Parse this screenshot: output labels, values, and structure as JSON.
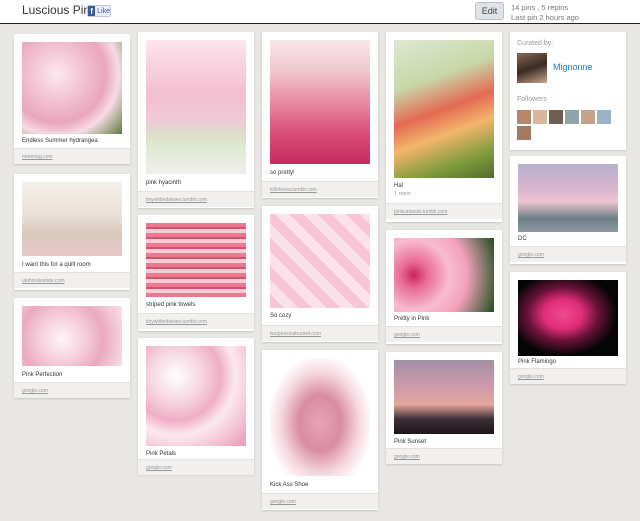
{
  "header": {
    "board_title": "Luscious Pink",
    "fb_like": "Like",
    "edit_label": "Edit",
    "stats_line1": "14 pins , 5 repins",
    "stats_line2": "Last pin 2 hours ago"
  },
  "sidebar": {
    "curated_by_label": "Curated by:",
    "curator_name": "Mignonne",
    "followers_label": "Followers",
    "followers": [
      "follower-1",
      "follower-2",
      "follower-3",
      "follower-4",
      "follower-5",
      "follower-6",
      "follower-7"
    ]
  },
  "pins": [
    {
      "desc": "Endless Summer hydrangea",
      "source": "marenag.com",
      "repins": ""
    },
    {
      "desc": "I want this for a quilt room",
      "source": "utahrealestate.com",
      "repins": ""
    },
    {
      "desc": "Pink Perfection",
      "source": "google.com",
      "repins": ""
    },
    {
      "desc": "pink hyacinth",
      "source": "tinywhitedaisies.tumblr.com",
      "repins": ""
    },
    {
      "desc": "striped pink towels",
      "source": "tinywhitedaisies.tumblr.com",
      "repins": ""
    },
    {
      "desc": "Pink Petals",
      "source": "google.com",
      "repins": ""
    },
    {
      "desc": "so pretty!",
      "source": "killohinea.tumblr.com",
      "repins": ""
    },
    {
      "desc": "So cozy",
      "source": "twopeasinabucket.com",
      "repins": ""
    },
    {
      "desc": "Kick Ass Shoe",
      "source": "google.com",
      "repins": ""
    },
    {
      "desc": "Ha!",
      "source": "pinkcatseals.tumblr.com",
      "repins": "1 repin"
    },
    {
      "desc": "Pretty in Pink",
      "source": "google.com",
      "repins": ""
    },
    {
      "desc": "Pink Sunset",
      "source": "google.com",
      "repins": ""
    },
    {
      "desc": "DC",
      "source": "google.com",
      "repins": ""
    },
    {
      "desc": "Pink Flamingo",
      "source": "google.com",
      "repins": ""
    }
  ]
}
